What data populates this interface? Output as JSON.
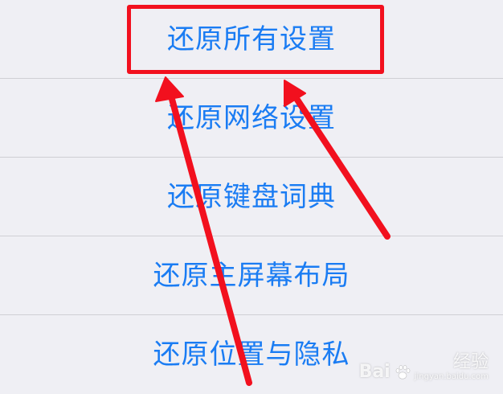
{
  "menu": {
    "items": [
      {
        "label": "还原所有设置"
      },
      {
        "label": "还原网络设置"
      },
      {
        "label": "还原键盘词典"
      },
      {
        "label": "还原主屏幕布局"
      },
      {
        "label": "还原位置与隐私"
      }
    ]
  },
  "annotation": {
    "highlight_color": "#f2101e",
    "highlighted_item": "还原所有设置"
  },
  "watermark": {
    "brand": "Bai",
    "icon": "paw-icon",
    "jingyan": "经验",
    "url": "jingyan.baidu.com"
  },
  "colors": {
    "label": "#1a7cf3",
    "background": "#efeff4",
    "separator": "#cfcfd4"
  }
}
